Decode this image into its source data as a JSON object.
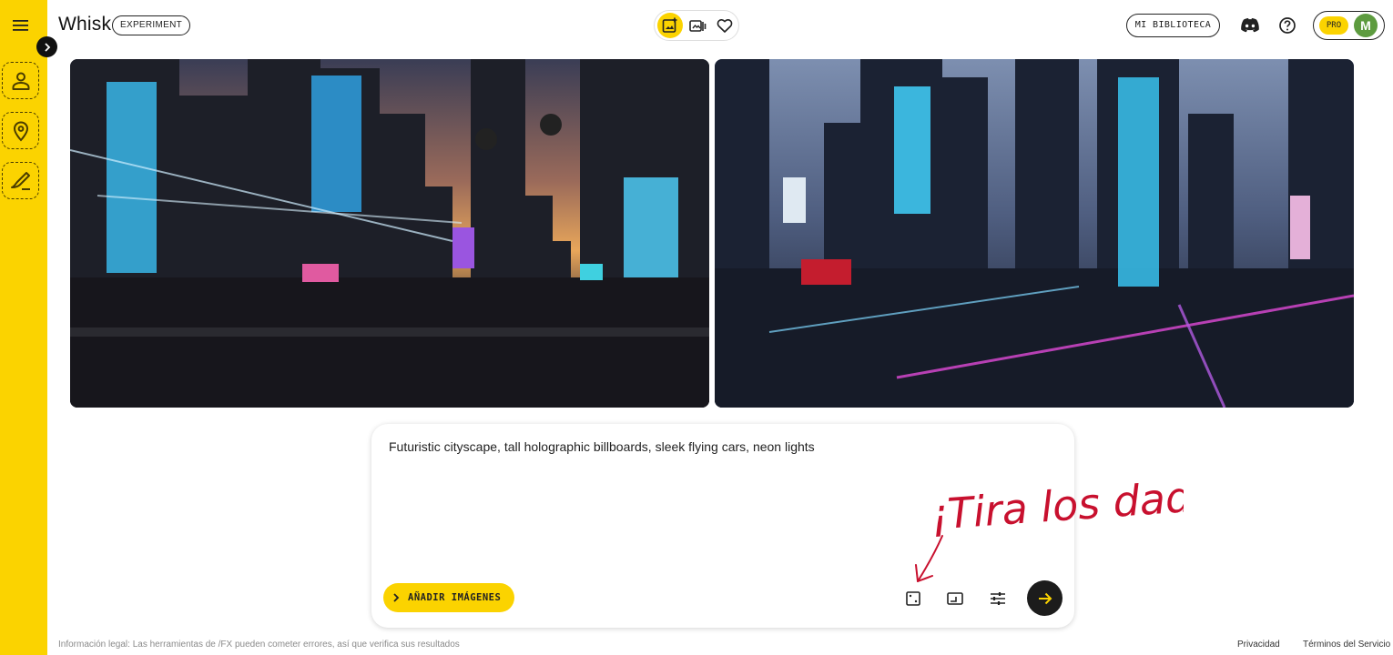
{
  "app": {
    "title": "Whisk",
    "badge": "EXPERIMENT"
  },
  "header": {
    "center_tools": [
      "image-add-icon",
      "history-icon",
      "favorites-icon"
    ],
    "library_label": "MI BIBLIOTECA",
    "plan_badge": "PRO",
    "avatar_initial": "M"
  },
  "sidebar": {
    "tools": [
      "subject-icon",
      "scene-icon",
      "style-icon"
    ]
  },
  "results": [
    {
      "alt": "futuristic city at sunset with holographic billboards"
    },
    {
      "alt": "futuristic city at night with neon holograms"
    }
  ],
  "prompt": {
    "text": "Futuristic cityscape, tall holographic billboards, sleek flying cars, neon lights",
    "add_images_label": "AÑADIR IMÁGENES"
  },
  "annotation": {
    "text": "¡Tira los dados!"
  },
  "footer": {
    "legal": "Información legal: Las herramientas de /FX pueden cometer errores, así que verifica sus resultados",
    "privacy": "Privacidad",
    "terms": "Términos del Servicio"
  },
  "colors": {
    "accent": "#fbd300",
    "send": "#1c1c1c",
    "annotation": "#c8102e"
  }
}
